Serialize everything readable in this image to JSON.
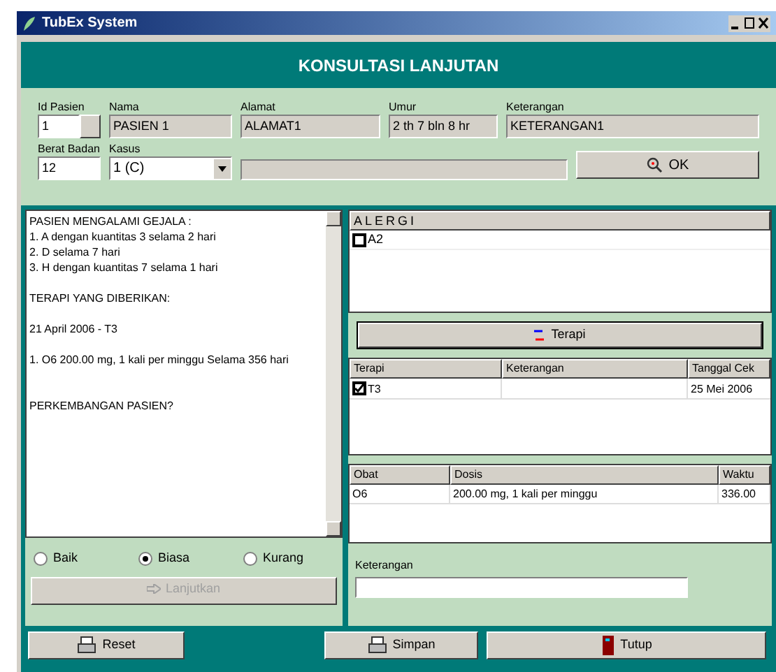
{
  "window": {
    "title": "TubEx System"
  },
  "header": {
    "title": "KONSULTASI LANJUTAN"
  },
  "form": {
    "id_pasien": {
      "label": "Id Pasien",
      "value": "1"
    },
    "nama": {
      "label": "Nama",
      "value": "PASIEN 1"
    },
    "alamat": {
      "label": "Alamat",
      "value": "ALAMAT1"
    },
    "umur": {
      "label": "Umur",
      "value": "2 th 7 bln 8 hr"
    },
    "keterangan": {
      "label": "Keterangan",
      "value": "KETERANGAN1"
    },
    "berat_badan": {
      "label": "Berat Badan",
      "value": "12"
    },
    "kasus": {
      "label": "Kasus",
      "value": "1 (C)"
    },
    "ok_button": "OK"
  },
  "notes": [
    [
      "PASIEN MENGALAMI GEJALA :",
      "1. A dengan kuantitas 3 selama 2 hari",
      "2. D selama 7 hari",
      "3. H dengan kuantitas 7 selama 1 hari"
    ],
    [
      "TERAPI YANG DIBERIKAN:"
    ],
    [
      "21 April 2006 - T3"
    ],
    [
      "1. O6 200.00 mg, 1 kali per minggu Selama 356 hari"
    ],
    [
      "PERKEMBANGAN PASIEN?"
    ]
  ],
  "condition": [
    {
      "label": "Baik",
      "selected": false
    },
    {
      "label": "Biasa",
      "selected": true
    },
    {
      "label": "Kurang",
      "selected": false
    }
  ],
  "lanjutkan_button": {
    "label": "Lanjutkan",
    "disabled": true
  },
  "alergi": {
    "title": "ALERGI",
    "items": [
      {
        "label": "A2",
        "checked": false
      }
    ]
  },
  "terapi_button": "Terapi",
  "terapi_table": {
    "columns": [
      "Terapi",
      "Keterangan",
      "Tanggal Cek"
    ],
    "rows": [
      {
        "terapi": "T3",
        "checked": true,
        "keterangan": "",
        "tanggal": "25 Mei 2006"
      }
    ]
  },
  "obat_table": {
    "columns": [
      "Obat",
      "Dosis",
      "Waktu"
    ],
    "rows": [
      [
        "O6",
        "200.00 mg, 1 kali per minggu",
        "336.00"
      ]
    ]
  },
  "keterangan_field": {
    "label": "Keterangan"
  },
  "buttons": [
    {
      "kind": "printer",
      "label": "Reset"
    },
    {
      "kind": "printer",
      "label": "Simpan"
    },
    {
      "kind": "door",
      "label": "Tutup"
    }
  ]
}
